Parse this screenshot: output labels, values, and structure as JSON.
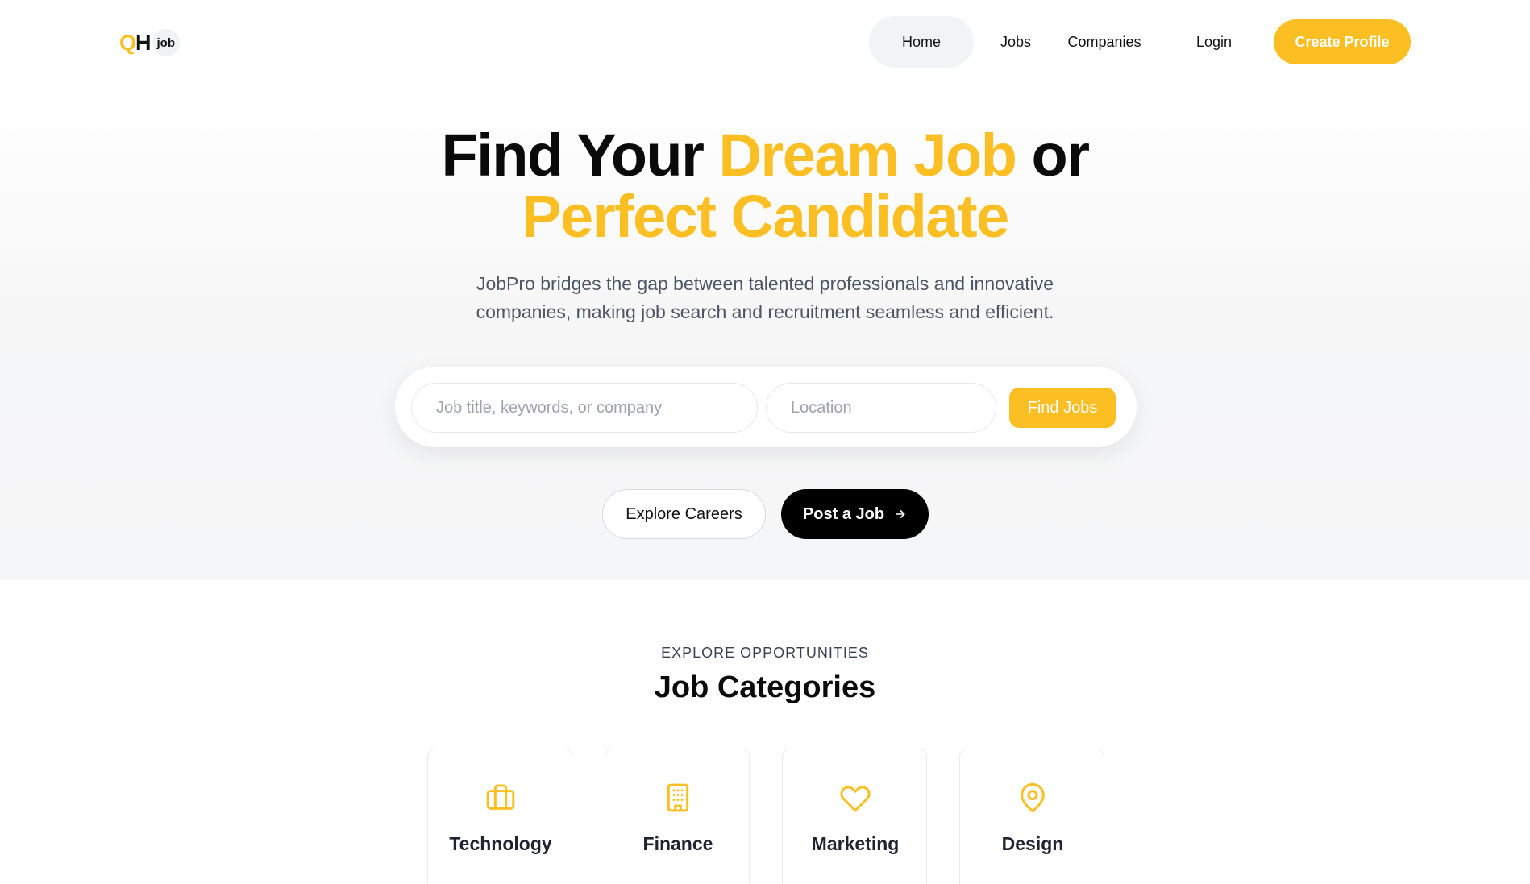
{
  "brand": {
    "logo_letters": "QH",
    "logo_badge": "job"
  },
  "nav": {
    "home": "Home",
    "jobs": "Jobs",
    "companies": "Companies",
    "login": "Login",
    "cta": "Create Profile"
  },
  "hero": {
    "title_part1": "Find Your ",
    "title_accent1": "Dream Job",
    "title_part2": " or",
    "title_accent2": "Perfect Candidate",
    "subtitle": "JobPro bridges the gap between talented professionals and innovative companies, making job search and recruitment seamless and efficient."
  },
  "search": {
    "keyword_placeholder": "Job title, keywords, or company",
    "location_placeholder": "Location",
    "button": "Find Jobs"
  },
  "actions": {
    "explore": "Explore Careers",
    "post": "Post a Job"
  },
  "categories": {
    "eyebrow": "EXPLORE OPPORTUNITIES",
    "title": "Job Categories",
    "items": [
      {
        "label": "Technology",
        "icon": "briefcase-icon"
      },
      {
        "label": "Finance",
        "icon": "building-icon"
      },
      {
        "label": "Marketing",
        "icon": "heart-icon"
      },
      {
        "label": "Design",
        "icon": "map-pin-icon"
      }
    ]
  },
  "colors": {
    "accent": "#fbbf24",
    "dark": "#000000"
  }
}
